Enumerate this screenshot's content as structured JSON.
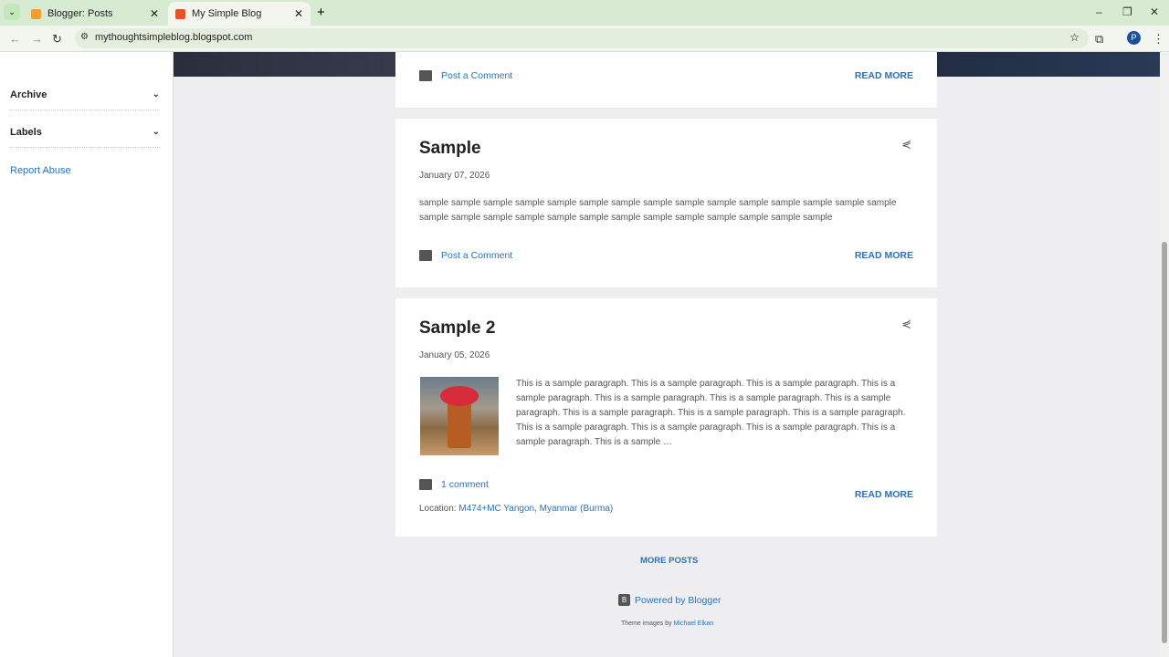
{
  "browser": {
    "tabs": [
      {
        "label": "Blogger: Posts",
        "active": false
      },
      {
        "label": "My Simple Blog",
        "active": true
      }
    ],
    "url": "mythoughtsimpleblog.blogspot.com",
    "profile_initial": "P"
  },
  "sidebar": {
    "archive": "Archive",
    "labels": "Labels",
    "report_abuse": "Report Abuse"
  },
  "posts": [
    {
      "comment_label": "Post a Comment",
      "read_more": "READ MORE"
    },
    {
      "title": "Sample",
      "date": "January 07, 2026",
      "snippet": "sample sample sample sample sample sample sample sample sample sample sample sample sample sample sample sample sample sample sample sample sample sample sample sample sample sample sample sample",
      "comment_label": "Post a Comment",
      "read_more": "READ MORE"
    },
    {
      "title": "Sample 2",
      "date": "January 05, 2026",
      "snippet": "This is a sample paragraph.  This is a sample paragraph.  This is a sample paragraph.  This is a sample paragraph.  This is a sample paragraph.  This is a sample paragraph.  This is a sample paragraph.  This is a sample paragraph.  This is a sample paragraph.  This is a sample paragraph.  This is a sample paragraph.  This is a sample paragraph.  This is a sample paragraph.  This is a sample paragraph.  This is a sample …",
      "comment_label": "1 comment",
      "location_label": "Location:",
      "location": "M474+MC Yangon, Myanmar (Burma)",
      "read_more": "READ MORE"
    }
  ],
  "footer": {
    "more_posts": "MORE POSTS",
    "powered": "Powered by Blogger",
    "theme_prefix": "Theme images by",
    "theme_author": "Michael Elkan"
  }
}
